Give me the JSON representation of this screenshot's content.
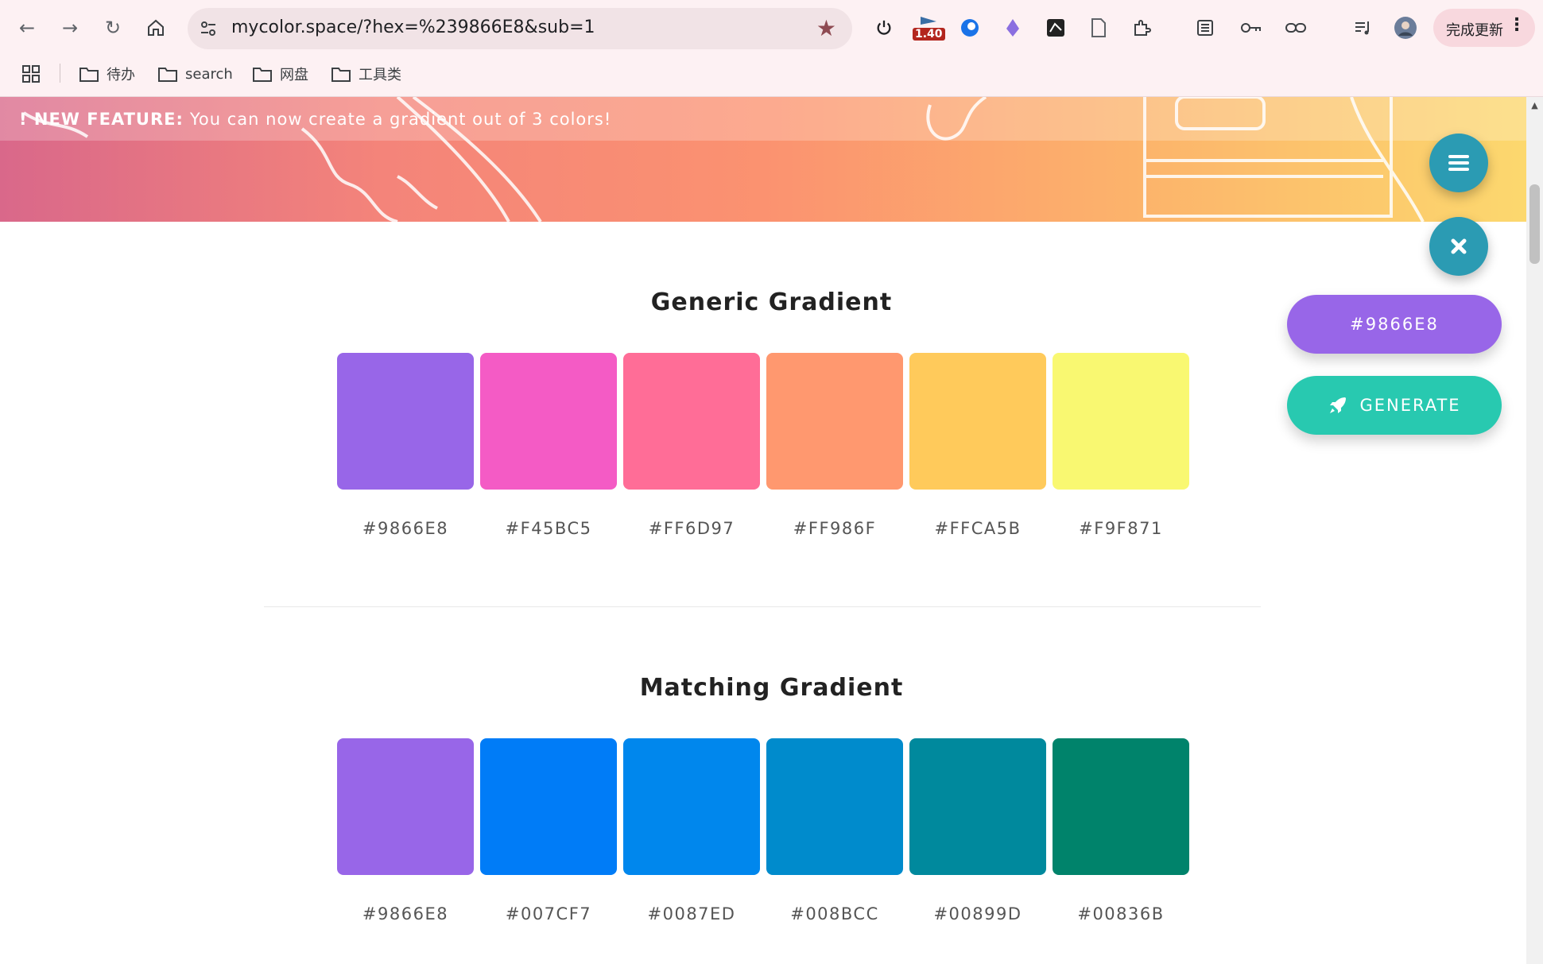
{
  "browser": {
    "url": "mycolor.space/?hex=%239866E8&sub=1",
    "extension_badge": "1.40",
    "update_button": "完成更新",
    "bookmarks": [
      "待办",
      "search",
      "网盘",
      "工具类"
    ]
  },
  "banner": {
    "feature_label": "! NEW FEATURE:",
    "feature_text": "You can now create a gradient out of 3 colors!"
  },
  "sections": [
    {
      "title": "Generic Gradient",
      "colors": [
        "#9866E8",
        "#F45BC5",
        "#FF6D97",
        "#FF986F",
        "#FFCA5B",
        "#F9F871"
      ]
    },
    {
      "title": "Matching Gradient",
      "colors": [
        "#9866E8",
        "#007CF7",
        "#0087ED",
        "#008BCC",
        "#00899D",
        "#00836B"
      ]
    }
  ],
  "floating": {
    "color_button": "#9866E8",
    "generate_button": "GENERATE",
    "generate_color": "#28C9B0",
    "fab_color": "#2B9BB3"
  }
}
